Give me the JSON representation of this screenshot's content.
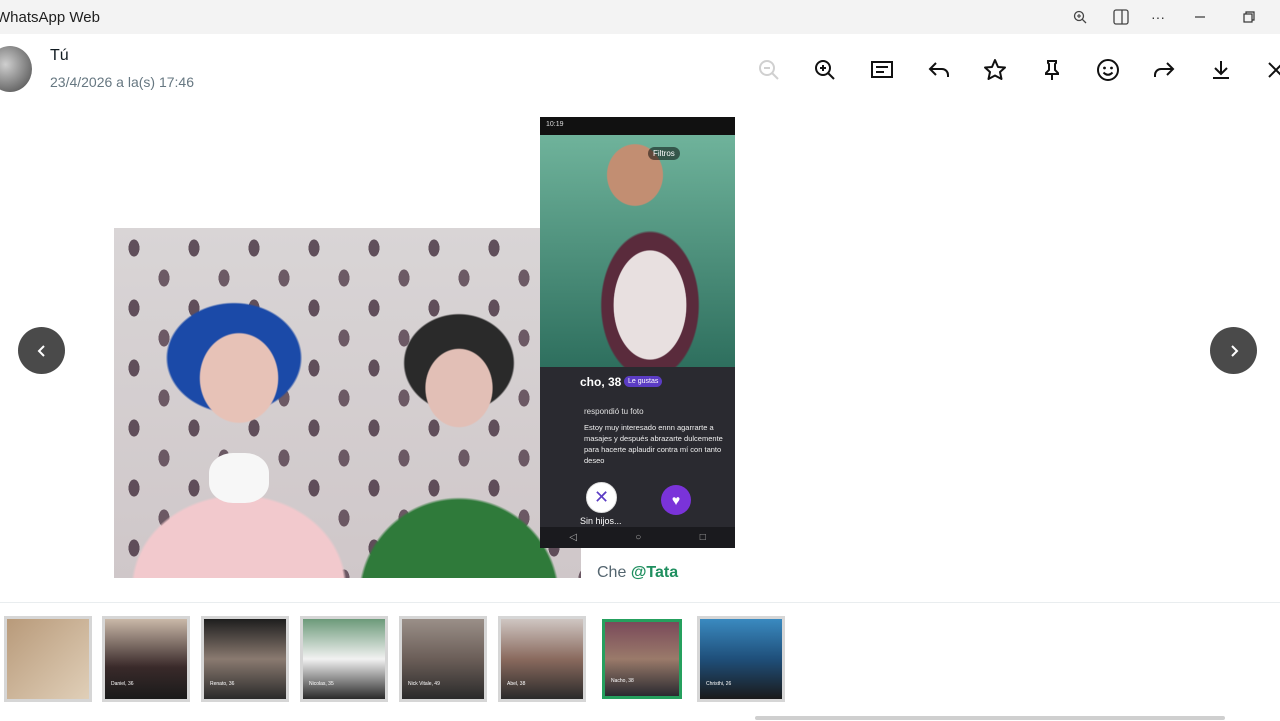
{
  "window": {
    "app_title": "WhatsApp Web",
    "controls": [
      "zoom-icon",
      "panel-icon",
      "more-icon",
      "minimize-icon",
      "restore-icon"
    ]
  },
  "viewer": {
    "sender_name": "Tú",
    "sent_at": "23/4/2026 a la(s) 17:46",
    "toolbar": [
      "zoom-out-icon",
      "zoom-in-icon",
      "message-icon",
      "reply-icon",
      "star-icon",
      "pin-icon",
      "react-emoji-icon",
      "forward-icon",
      "download-icon",
      "close-icon"
    ],
    "caption_prefix": "Che",
    "caption_mention": "@Tata"
  },
  "phone_screenshot": {
    "status_time": "10:19",
    "filter_label": "Filtros",
    "profile_name": "cho, 38",
    "badge": "Le gustas",
    "reply_note": "respondió tu foto",
    "message": "Estoy muy interesado ennn agarrarte a masajes y después abrazarte dulcemente para hacerte aplaudir contra mí con tanto deseo",
    "sub_text": "Sin hijos..."
  },
  "thumbnails": [
    {
      "label": ""
    },
    {
      "label": "Daniel, 36"
    },
    {
      "label": "Renato, 36"
    },
    {
      "label": "Nicolas, 35"
    },
    {
      "label": "Nick Vitale, 49"
    },
    {
      "label": "Abel, 38"
    },
    {
      "label": "Nacho, 38"
    },
    {
      "label": "Christhi, 26"
    }
  ]
}
